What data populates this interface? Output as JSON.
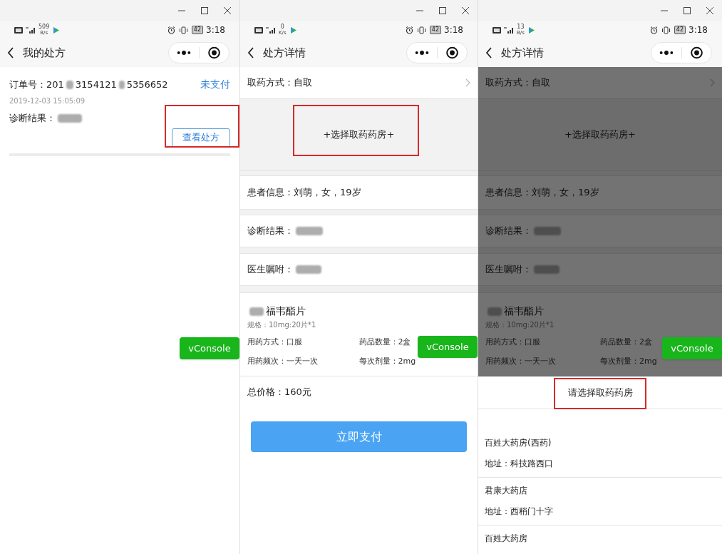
{
  "panels": [
    {
      "kind": "order_list",
      "status": {
        "speed": "509",
        "speed_unit": "B/s",
        "battery": "42",
        "time": "3:18"
      },
      "nav_title": "我的处方",
      "order": {
        "number_parts": [
          "订单号：201",
          "3154121",
          "5356652"
        ],
        "state": "未支付",
        "date": "2019-12-03 15:05:09",
        "diagnosis_label": "诊断结果：",
        "button": {
          "label": "查看处方",
          "annotated": true
        }
      },
      "vconsole": "vConsole"
    },
    {
      "kind": "detail",
      "overlay": false,
      "status": {
        "speed": "0",
        "speed_unit": "K/s",
        "battery": "42",
        "time": "3:18"
      },
      "nav_title": "处方详情",
      "pickup": "取药方式：自取",
      "pharmacy_button": {
        "label": "+选择取药药房+",
        "annotated": true
      },
      "patient": "患者信息：刘萌，女，19岁",
      "diagnosis_label": "诊断结果：",
      "doctor_label": "医生嘱咐：",
      "drug": {
        "name": "福韦酯片",
        "spec": "规格：10mg:20片*1",
        "fields": [
          "用药方式：口服",
          "药品数量：2盒",
          "用药频次：一天一次",
          "每次剂量：2mg"
        ]
      },
      "total": "总价格：160元",
      "pay_button": "立即支付",
      "vconsole": "vConsole"
    },
    {
      "kind": "detail",
      "overlay": true,
      "status": {
        "speed": "13",
        "speed_unit": "B/s",
        "battery": "42",
        "time": "3:18"
      },
      "nav_title": "处方详情",
      "pickup": "取药方式：自取",
      "pharmacy_button": {
        "label": "+选择取药药房+",
        "annotated": false
      },
      "patient": "患者信息：刘萌，女，19岁",
      "diagnosis_label": "诊断结果：",
      "doctor_label": "医生嘱咐：",
      "drug": {
        "name": "福韦酯片",
        "spec": "规格：10mg:20片*1",
        "fields": [
          "用药方式：口服",
          "药品数量：2盒",
          "用药频次：一天一次",
          "每次剂量：2mg"
        ]
      },
      "vconsole": "vConsole",
      "sheet": {
        "title": {
          "label": "请选择取药药房",
          "annotated": true
        },
        "pharmacies": [
          {
            "name": "百姓大药房(西药)",
            "address": "地址：科技路西口"
          },
          {
            "name": "君康大药店",
            "address": "地址：西稍门十字"
          },
          {
            "name": "百姓大药房"
          }
        ]
      }
    }
  ]
}
